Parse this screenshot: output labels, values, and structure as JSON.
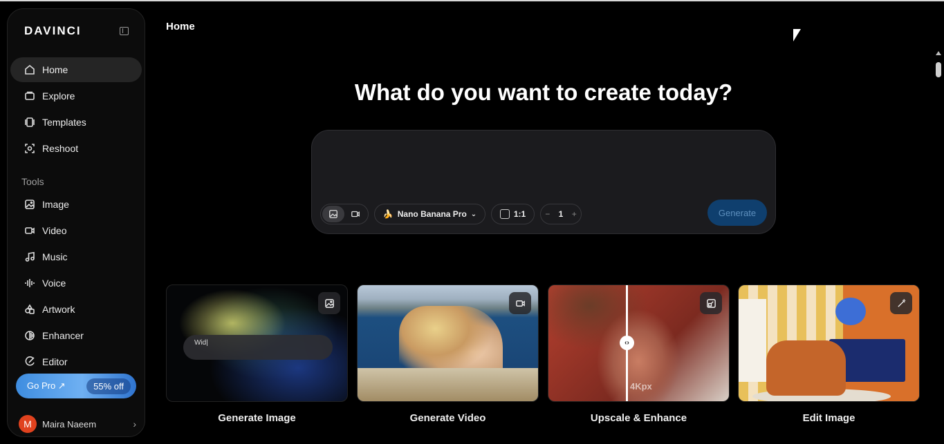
{
  "brand": {
    "logo": "DAVINCI"
  },
  "sidebar": {
    "main_items": [
      {
        "label": "Home",
        "icon": "home-icon",
        "active": true
      },
      {
        "label": "Explore",
        "icon": "explore-icon"
      },
      {
        "label": "Templates",
        "icon": "templates-icon"
      },
      {
        "label": "Reshoot",
        "icon": "reshoot-icon"
      }
    ],
    "tools_label": "Tools",
    "tool_items": [
      {
        "label": "Image",
        "icon": "image-icon"
      },
      {
        "label": "Video",
        "icon": "video-icon"
      },
      {
        "label": "Music",
        "icon": "music-icon"
      },
      {
        "label": "Voice",
        "icon": "voice-icon"
      },
      {
        "label": "Artwork",
        "icon": "artwork-icon"
      },
      {
        "label": "Enhancer",
        "icon": "enhancer-icon"
      },
      {
        "label": "Editor",
        "icon": "editor-icon"
      }
    ],
    "go_pro": {
      "label": "Go Pro ↗",
      "discount": "55% off"
    },
    "user": {
      "initial": "M",
      "name": "Maira Naeem"
    }
  },
  "header": {
    "title": "Home"
  },
  "hero": {
    "headline": "What do you want to create today?"
  },
  "composer": {
    "prompt_value": "",
    "model": "Nano Banana Pro",
    "aspect_ratio": "1:1",
    "count": "1",
    "decrement": "−",
    "increment": "+",
    "generate_label": "Generate"
  },
  "cards": [
    {
      "label": "Generate Image",
      "icon": "image-icon",
      "typing_text": "Wid|"
    },
    {
      "label": "Generate Video",
      "icon": "video-icon"
    },
    {
      "label": "Upscale & Enhance",
      "icon": "upscale-icon",
      "overlay_text": "4Kpx",
      "handle": "‹›"
    },
    {
      "label": "Edit Image",
      "icon": "edit-brush-icon"
    }
  ],
  "colors": {
    "accent": "#3e8de0",
    "generate_disabled_bg": "#0f3f6e",
    "avatar": "#e0421e"
  }
}
